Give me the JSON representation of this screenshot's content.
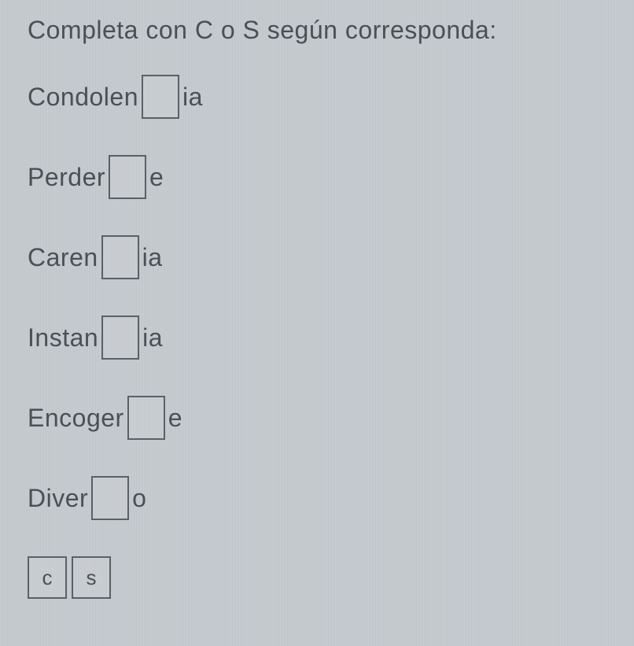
{
  "instruction": "Completa con C o S según corresponda:",
  "words": [
    {
      "prefix": "Condolen",
      "suffix": "ia"
    },
    {
      "prefix": "Perder",
      "suffix": "e"
    },
    {
      "prefix": "Caren",
      "suffix": "ia"
    },
    {
      "prefix": "Instan",
      "suffix": "ia"
    },
    {
      "prefix": "Encoger",
      "suffix": "e"
    },
    {
      "prefix": "Diver",
      "suffix": "o"
    }
  ],
  "tiles": {
    "c": "c",
    "s": "s"
  }
}
